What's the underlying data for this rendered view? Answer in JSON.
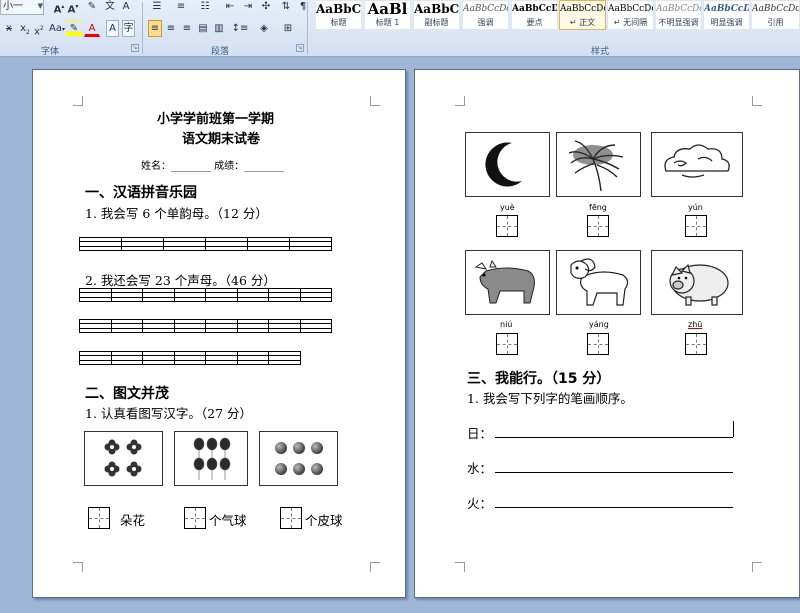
{
  "ribbon": {
    "font_size_value": "小一",
    "font_group_label": "字体",
    "paragraph_group_label": "段落",
    "styles_group_label": "样式",
    "styles": [
      {
        "sample": "AaBbC",
        "name": "标题"
      },
      {
        "sample": "AaBl",
        "name": "标题 1"
      },
      {
        "sample": "AaBbC",
        "name": "副标题"
      },
      {
        "sample": "AaBbCcDd",
        "name": "强调"
      },
      {
        "sample": "AaBbCcD",
        "name": "要点"
      },
      {
        "sample": "AaBbCcDc",
        "name": "↵ 正文"
      },
      {
        "sample": "AaBbCcDc",
        "name": "↵ 无间隔"
      },
      {
        "sample": "AaBbCcDd",
        "name": "不明显强调"
      },
      {
        "sample": "AaBbCcDd",
        "name": "明显强调"
      },
      {
        "sample": "AaBbCcDd",
        "name": "引用"
      }
    ],
    "selected_style": "↵ 正文"
  },
  "page1": {
    "title_line1": "小学学前班第一学期",
    "title_line2": "语文期末试卷",
    "name_line": "姓名：________  成绩：________",
    "section1": "一、汉语拼音乐园",
    "q1": "1. 我会写 6 个单韵母。（12 分）",
    "q2": "2. 我还会写 23 个声母。（46 分）",
    "section2": "二、图文并茂",
    "q3": "1. 认真看图写汉字。（27 分）",
    "count_labels": [
      "朵花",
      "个气球",
      "个皮球"
    ]
  },
  "page2": {
    "pinyin_row1": [
      "yuè",
      "fēng",
      "yún"
    ],
    "pinyin_row2": [
      "niú",
      "yáng",
      "zhū"
    ],
    "picture_row1": [
      "moon",
      "windy-tree",
      "cloud"
    ],
    "picture_row2": [
      "ox",
      "sheep",
      "pig"
    ],
    "section3": "三、我能行。（15 分）",
    "q4": "1. 我会写下列字的笔画顺序。",
    "stroke_chars": [
      "日：",
      "水：",
      "火："
    ]
  }
}
